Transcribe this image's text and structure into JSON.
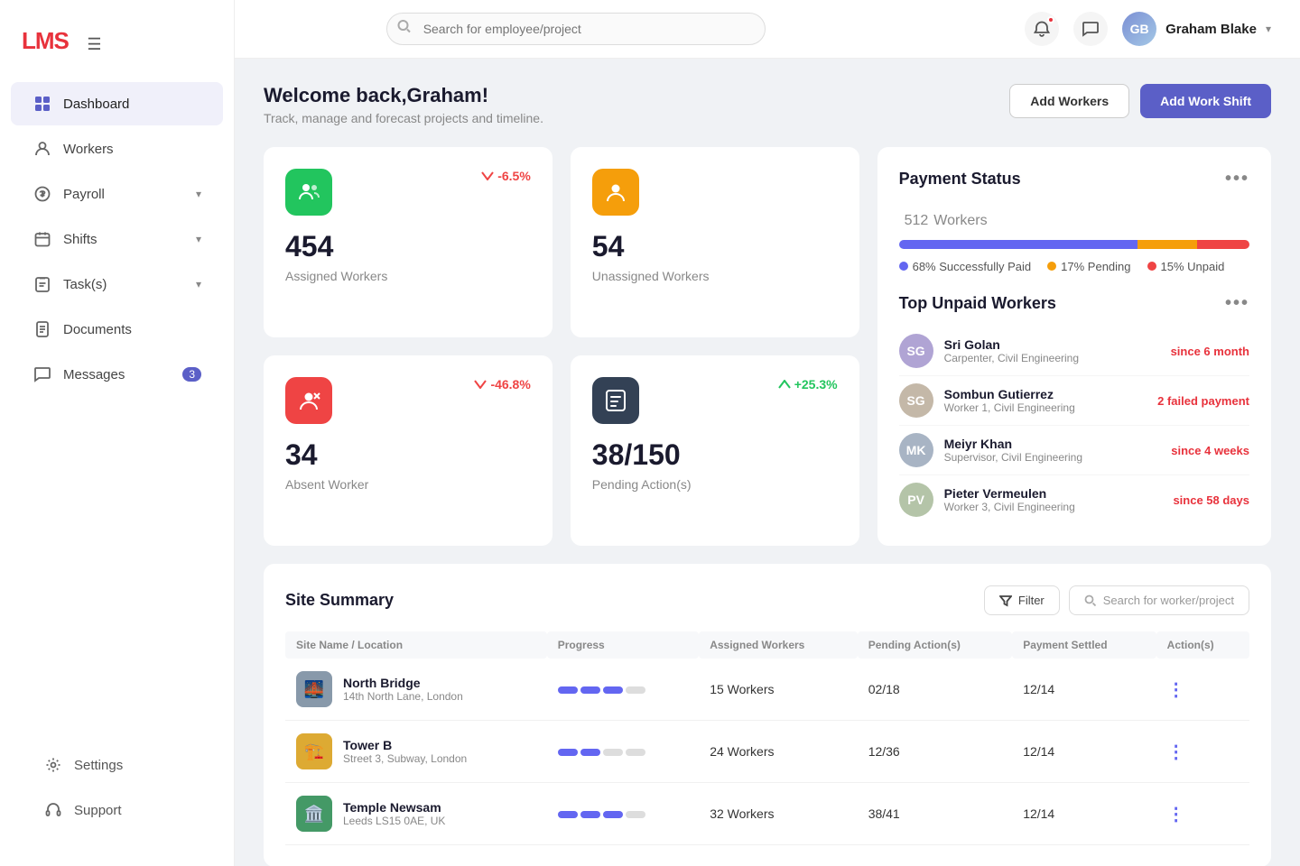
{
  "app": {
    "name": "LMS"
  },
  "topbar": {
    "search_placeholder": "Search for employee/project",
    "user_name": "Graham Blake"
  },
  "sidebar": {
    "items": [
      {
        "id": "dashboard",
        "label": "Dashboard",
        "icon": "grid",
        "active": true
      },
      {
        "id": "workers",
        "label": "Workers",
        "icon": "person"
      },
      {
        "id": "payroll",
        "label": "Payroll",
        "icon": "dollar",
        "has_arrow": true
      },
      {
        "id": "shifts",
        "label": "Shifts",
        "icon": "calendar",
        "has_arrow": true
      },
      {
        "id": "tasks",
        "label": "Task(s)",
        "icon": "clipboard",
        "has_arrow": true
      },
      {
        "id": "documents",
        "label": "Documents",
        "icon": "doc"
      },
      {
        "id": "messages",
        "label": "Messages",
        "icon": "chat",
        "badge": "3"
      }
    ],
    "bottom": [
      {
        "id": "settings",
        "label": "Settings",
        "icon": "gear"
      },
      {
        "id": "support",
        "label": "Support",
        "icon": "headphone"
      }
    ]
  },
  "page": {
    "welcome": "Welcome back,Graham!",
    "subtitle": "Track, manage and forecast projects and timeline.",
    "btn_add_workers": "Add Workers",
    "btn_add_shift": "Add Work Shift"
  },
  "stats": [
    {
      "icon": "assigned",
      "icon_color": "green",
      "change": "-6.5%",
      "change_dir": "down",
      "value": "454",
      "label": "Assigned Workers"
    },
    {
      "icon": "unassigned",
      "icon_color": "orange",
      "change": "",
      "change_dir": "",
      "value": "54",
      "label": "Unassigned Workers"
    },
    {
      "icon": "absent",
      "icon_color": "red",
      "change": "-46.8%",
      "change_dir": "down",
      "value": "34",
      "label": "Absent Worker"
    },
    {
      "icon": "pending",
      "icon_color": "dark",
      "change": "+25.3%",
      "change_dir": "up",
      "value": "38/150",
      "label": "Pending Action(s)"
    }
  ],
  "payment": {
    "title": "Payment Status",
    "total": "512",
    "total_label": "Workers",
    "bars": [
      {
        "pct": 68,
        "color": "purple",
        "label": "68%",
        "desc": "Successfully Paid"
      },
      {
        "pct": 17,
        "color": "orange",
        "label": "17%",
        "desc": "Pending"
      },
      {
        "pct": 15,
        "color": "red",
        "label": "15%",
        "desc": "Unpaid"
      }
    ]
  },
  "unpaid": {
    "title": "Top Unpaid Workers",
    "workers": [
      {
        "name": "Sri Golan",
        "role": "Carpenter, Civil Engineering",
        "status": "since 6 month",
        "color": "#b0a4d4"
      },
      {
        "name": "Sombun Gutierrez",
        "role": "Worker 1, Civil Engineering",
        "status": "2 failed payment",
        "color": "#c4b8a8"
      },
      {
        "name": "Meiyr Khan",
        "role": "Supervisor, Civil Engineering",
        "status": "since 4 weeks",
        "color": "#a8b4c4"
      },
      {
        "name": "Pieter Vermeulen",
        "role": "Worker 3, Civil Engineering",
        "status": "since 58 days",
        "color": "#b4c4a8"
      }
    ]
  },
  "site_summary": {
    "title": "Site Summary",
    "filter_btn": "Filter",
    "search_placeholder": "Search for worker/project",
    "columns": [
      "Site Name / Location",
      "Progress",
      "Assigned Workers",
      "Pending Action(s)",
      "Payment Settled",
      "Action(s)"
    ],
    "rows": [
      {
        "name": "North Bridge",
        "location": "14th North Lane, London",
        "progress_filled": 3,
        "progress_total": 4,
        "assigned": "15 Workers",
        "pending": "02/18",
        "payment": "12/14",
        "color": "#555"
      },
      {
        "name": "Tower B",
        "location": "Street 3, Subway, London",
        "progress_filled": 2,
        "progress_total": 4,
        "assigned": "24 Workers",
        "pending": "12/36",
        "payment": "12/14",
        "color": "#cc3"
      },
      {
        "name": "Temple Newsam",
        "location": "Leeds LS15 0AE, UK",
        "progress_filled": 3,
        "progress_total": 4,
        "assigned": "32 Workers",
        "pending": "38/41",
        "payment": "12/14",
        "color": "#5a9"
      }
    ]
  }
}
